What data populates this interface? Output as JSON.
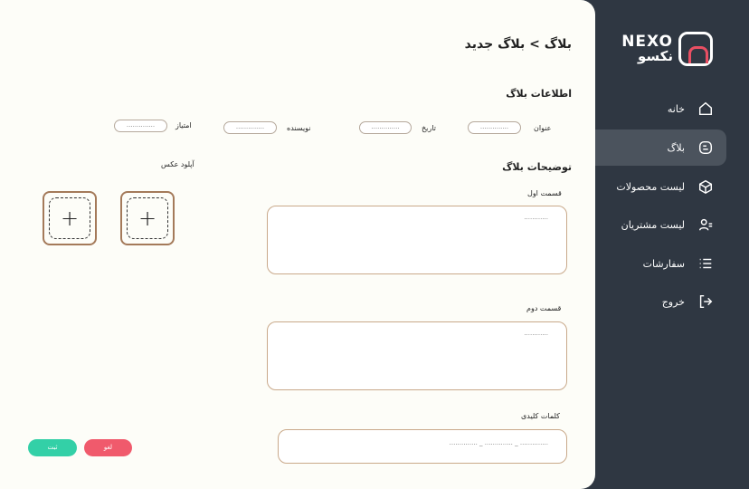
{
  "brand": {
    "name_en": "NEXO",
    "name_fa": "نکسو"
  },
  "nav": [
    {
      "label": "خانه",
      "icon": "home-icon"
    },
    {
      "label": "بلاگ",
      "icon": "blog-icon"
    },
    {
      "label": "لیست محصولات",
      "icon": "products-icon"
    },
    {
      "label": "لیست مشتریان",
      "icon": "customers-icon"
    },
    {
      "label": "سفارشات",
      "icon": "orders-icon"
    },
    {
      "label": "خروج",
      "icon": "logout-icon"
    }
  ],
  "header": {
    "breadcrumb": "بلاگ > بلاگ جدید"
  },
  "info": {
    "title": "اطلاعات بلاگ",
    "fields": {
      "title_label": "عنوان",
      "title_placeholder": "..............",
      "date_label": "تاریخ",
      "date_placeholder": "..............",
      "author_label": "نویسنده",
      "author_placeholder": "..............",
      "score_label": "امتیاز",
      "score_placeholder": ".............."
    }
  },
  "desc": {
    "title": "توضیحات بلاگ",
    "part1_label": "قسمت اول",
    "part1_placeholder": "............",
    "part2_label": "قسمت دوم",
    "part2_placeholder": "............",
    "keywords_label": "کلمات کلیدی",
    "keywords_placeholder": ".............. _ .............. _ .............."
  },
  "upload": {
    "label": "آپلود عکس"
  },
  "actions": {
    "submit": "ثبت",
    "cancel": "لغو"
  },
  "colors": {
    "sidebar": "#2f3742",
    "submit": "#33d0a7",
    "cancel": "#f05a6c",
    "accent": "#e94f63"
  }
}
